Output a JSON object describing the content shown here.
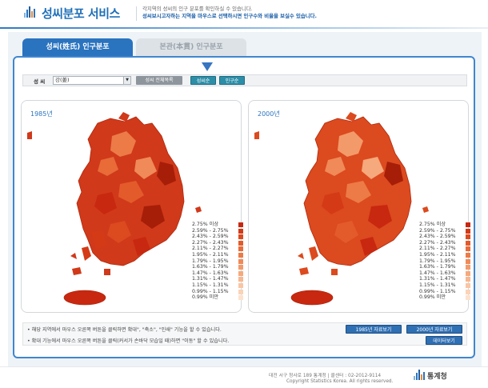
{
  "header": {
    "app_title": "성씨분포 서비스",
    "desc_line1": "각지역의 성씨의 인구 분포를 확인하실 수 있습니다.",
    "desc_line2": "성씨보시고자하는 지역을 마우스로 선택하시면 인구수와 비율을 보실수 있습니다."
  },
  "tabs": [
    {
      "label": "성씨(姓氏) 인구분포",
      "active": true
    },
    {
      "label": "본관(本貫) 인구분포",
      "active": false
    }
  ],
  "search": {
    "label": "성 씨",
    "selected_value": "강(姜)",
    "list_button": "성씨 전체목록",
    "ratio_button": "성씨순",
    "population_button": "인구순"
  },
  "maps": [
    {
      "year_label": "1985년"
    },
    {
      "year_label": "2000년"
    }
  ],
  "legend": [
    {
      "label": "2.75% 이상",
      "color": "#c8280f"
    },
    {
      "label": "2.59% - 2.75%",
      "color": "#d43a16"
    },
    {
      "label": "2.43% - 2.59%",
      "color": "#dc4a1f"
    },
    {
      "label": "2.27% - 2.43%",
      "color": "#e35b2b"
    },
    {
      "label": "2.11% - 2.27%",
      "color": "#e86b38"
    },
    {
      "label": "1.95% - 2.11%",
      "color": "#ec7b47"
    },
    {
      "label": "1.79% - 1.95%",
      "color": "#f08a58"
    },
    {
      "label": "1.63% - 1.79%",
      "color": "#f39a6a"
    },
    {
      "label": "1.47% - 1.63%",
      "color": "#f5a97c"
    },
    {
      "label": "1.31% - 1.47%",
      "color": "#f7b78f"
    },
    {
      "label": "1.15% - 1.31%",
      "color": "#f9c5a3"
    },
    {
      "label": "0.99% - 1.15%",
      "color": "#fbd3b8"
    },
    {
      "label": "0.99% 미만",
      "color": "#fde2cf"
    }
  ],
  "notes": [
    "해당 지역에서 마우스 오른쪽 버튼을 클릭하면 확대\", \"축소\", \"인쇄\" 기능을 할 수 있습니다.",
    "확대 기능에서 마우스 오른쪽 버튼을 클릭(커서가 손바닥 모습일 때)하면 \"이동\" 할 수 있습니다."
  ],
  "buttons": {
    "data_1985": "1985년 자료보기",
    "data_2000": "2000년 자료보기",
    "data_view": "데이터보기"
  },
  "footer": {
    "address": "대전 서구 청사로 189 통계청 | 콜센터 : 02-2012-9114",
    "copyright": "Copyright Statistics Korea. All rights reserved.",
    "org_name": "통계청"
  },
  "colors": {
    "brand_blue": "#2a73bf",
    "map_red": "#d0391a",
    "map_dark": "#a61e08"
  }
}
